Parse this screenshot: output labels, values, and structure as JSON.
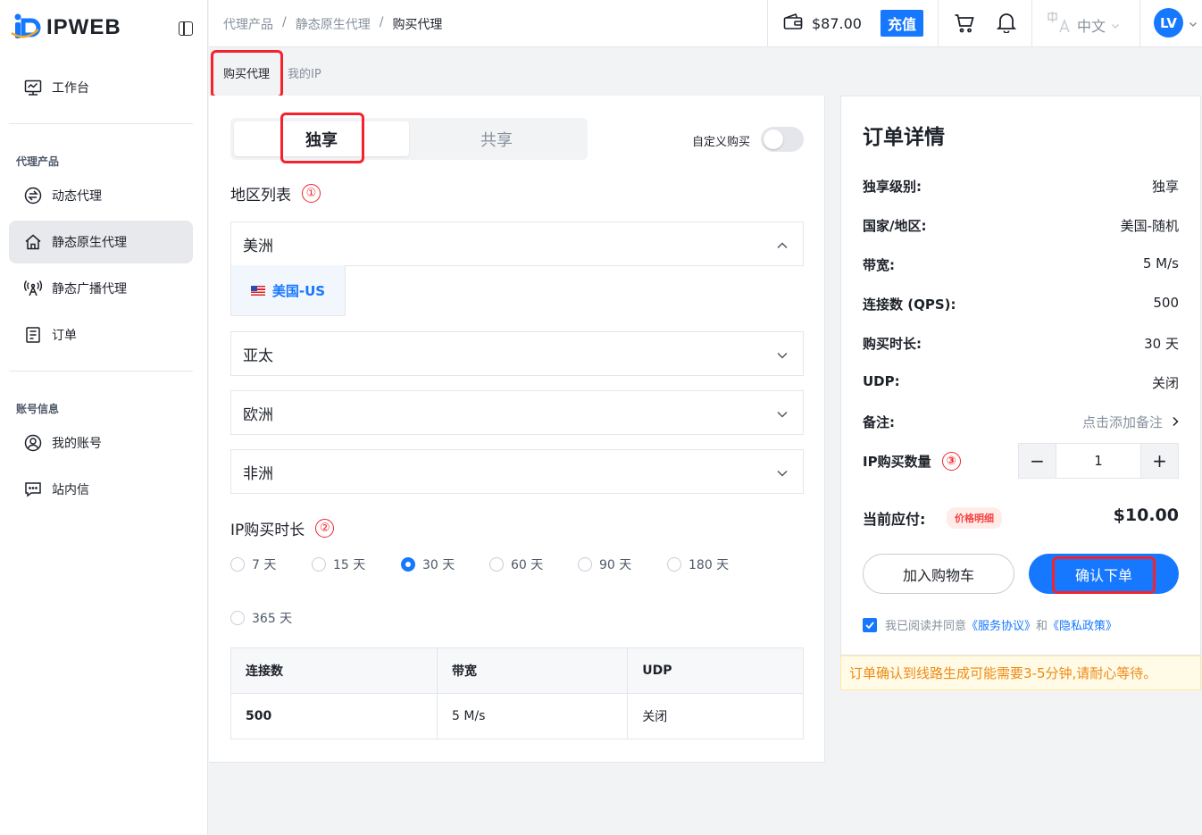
{
  "app": {
    "brand": "IPWEB"
  },
  "sidebar": {
    "workbench": "工作台",
    "section_proxy": "代理产品",
    "items_proxy": [
      "动态代理",
      "静态原生代理",
      "静态广播代理",
      "订单"
    ],
    "section_account": "账号信息",
    "items_account": [
      "我的账号",
      "站内信"
    ]
  },
  "header": {
    "breadcrumb": [
      "代理产品",
      "/",
      "静态原生代理",
      "/",
      "购买代理"
    ],
    "balance": "$87.00",
    "recharge": "充值",
    "language": "中文",
    "avatar": "LV"
  },
  "subtabs": {
    "buy": "购买代理",
    "my_ip": "我的IP"
  },
  "purchase": {
    "type_options": [
      "独享",
      "共享"
    ],
    "custom_buy": "自定义购买",
    "region_title": "地区列表",
    "markers": [
      "①",
      "②",
      "③"
    ],
    "regions": [
      "美洲",
      "亚太",
      "欧洲",
      "非洲"
    ],
    "selected_country": "美国-US",
    "duration_title": "IP购买时长",
    "durations": [
      "7 天",
      "15 天",
      "30 天",
      "60 天",
      "90 天",
      "180 天",
      "365 天"
    ],
    "selected_duration": "30 天",
    "spec_headers": [
      "连接数",
      "带宽",
      "UDP"
    ],
    "spec_values": [
      "500",
      "5 M/s",
      "关闭"
    ]
  },
  "order": {
    "title": "订单详情",
    "rows": [
      {
        "label": "独享级别:",
        "value": "独享"
      },
      {
        "label": "国家/地区:",
        "value": "美国-随机"
      },
      {
        "label": "带宽:",
        "value": "5 M/s"
      },
      {
        "label": "连接数 (QPS):",
        "value": "500"
      },
      {
        "label": "购买时长:",
        "value": "30 天"
      },
      {
        "label": "UDP:",
        "value": "关闭"
      },
      {
        "label": "备注:",
        "value": "点击添加备注"
      }
    ],
    "qty_label": "IP购买数量",
    "qty_minus": "−",
    "qty_value": "1",
    "qty_plus": "+",
    "total_label": "当前应付:",
    "price_detail": "价格明细",
    "total": "$10.00",
    "add_cart": "加入购物车",
    "confirm": "确认下单",
    "agree_prefix": "我已阅读并同意",
    "agree_service": "《服务协议》",
    "agree_and": "和",
    "agree_privacy": "《隐私政策》"
  },
  "notice": "订单确认到线路生成可能需要3-5分钟,请耐心等待。",
  "colors": {
    "accent": "#1677ff",
    "highlight": "#f5222d",
    "notice": "#ee8a16"
  }
}
